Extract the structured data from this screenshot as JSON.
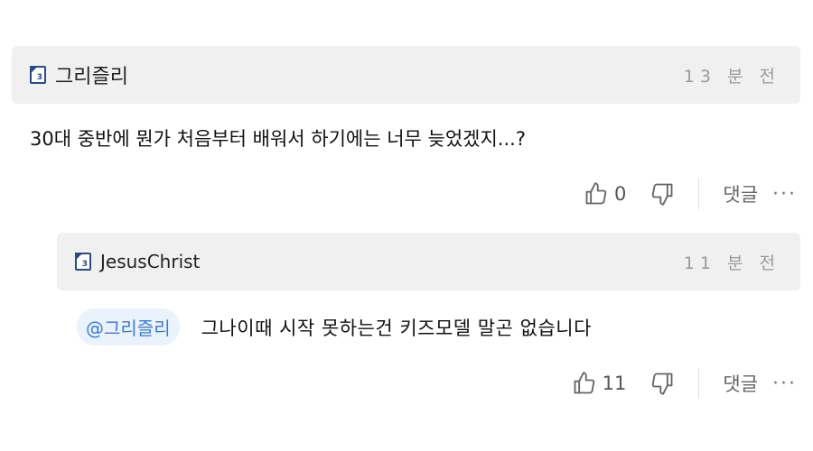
{
  "comments": [
    {
      "author": "그리즐리",
      "level": "3",
      "time": "13 분 전",
      "text": "30대 중반에 뭔가 처음부터 배워서 하기에는 너무 늦었겠지...?",
      "likes": "0",
      "reply_label": "댓글",
      "more_label": "···"
    },
    {
      "author": "JesusChrist",
      "level": "3",
      "time": "11 분 전",
      "mention": "@그리즐리",
      "text": "그나이때 시작 못하는건 키즈모델 말곤 없습니다",
      "likes": "11",
      "reply_label": "댓글",
      "more_label": "···"
    }
  ]
}
